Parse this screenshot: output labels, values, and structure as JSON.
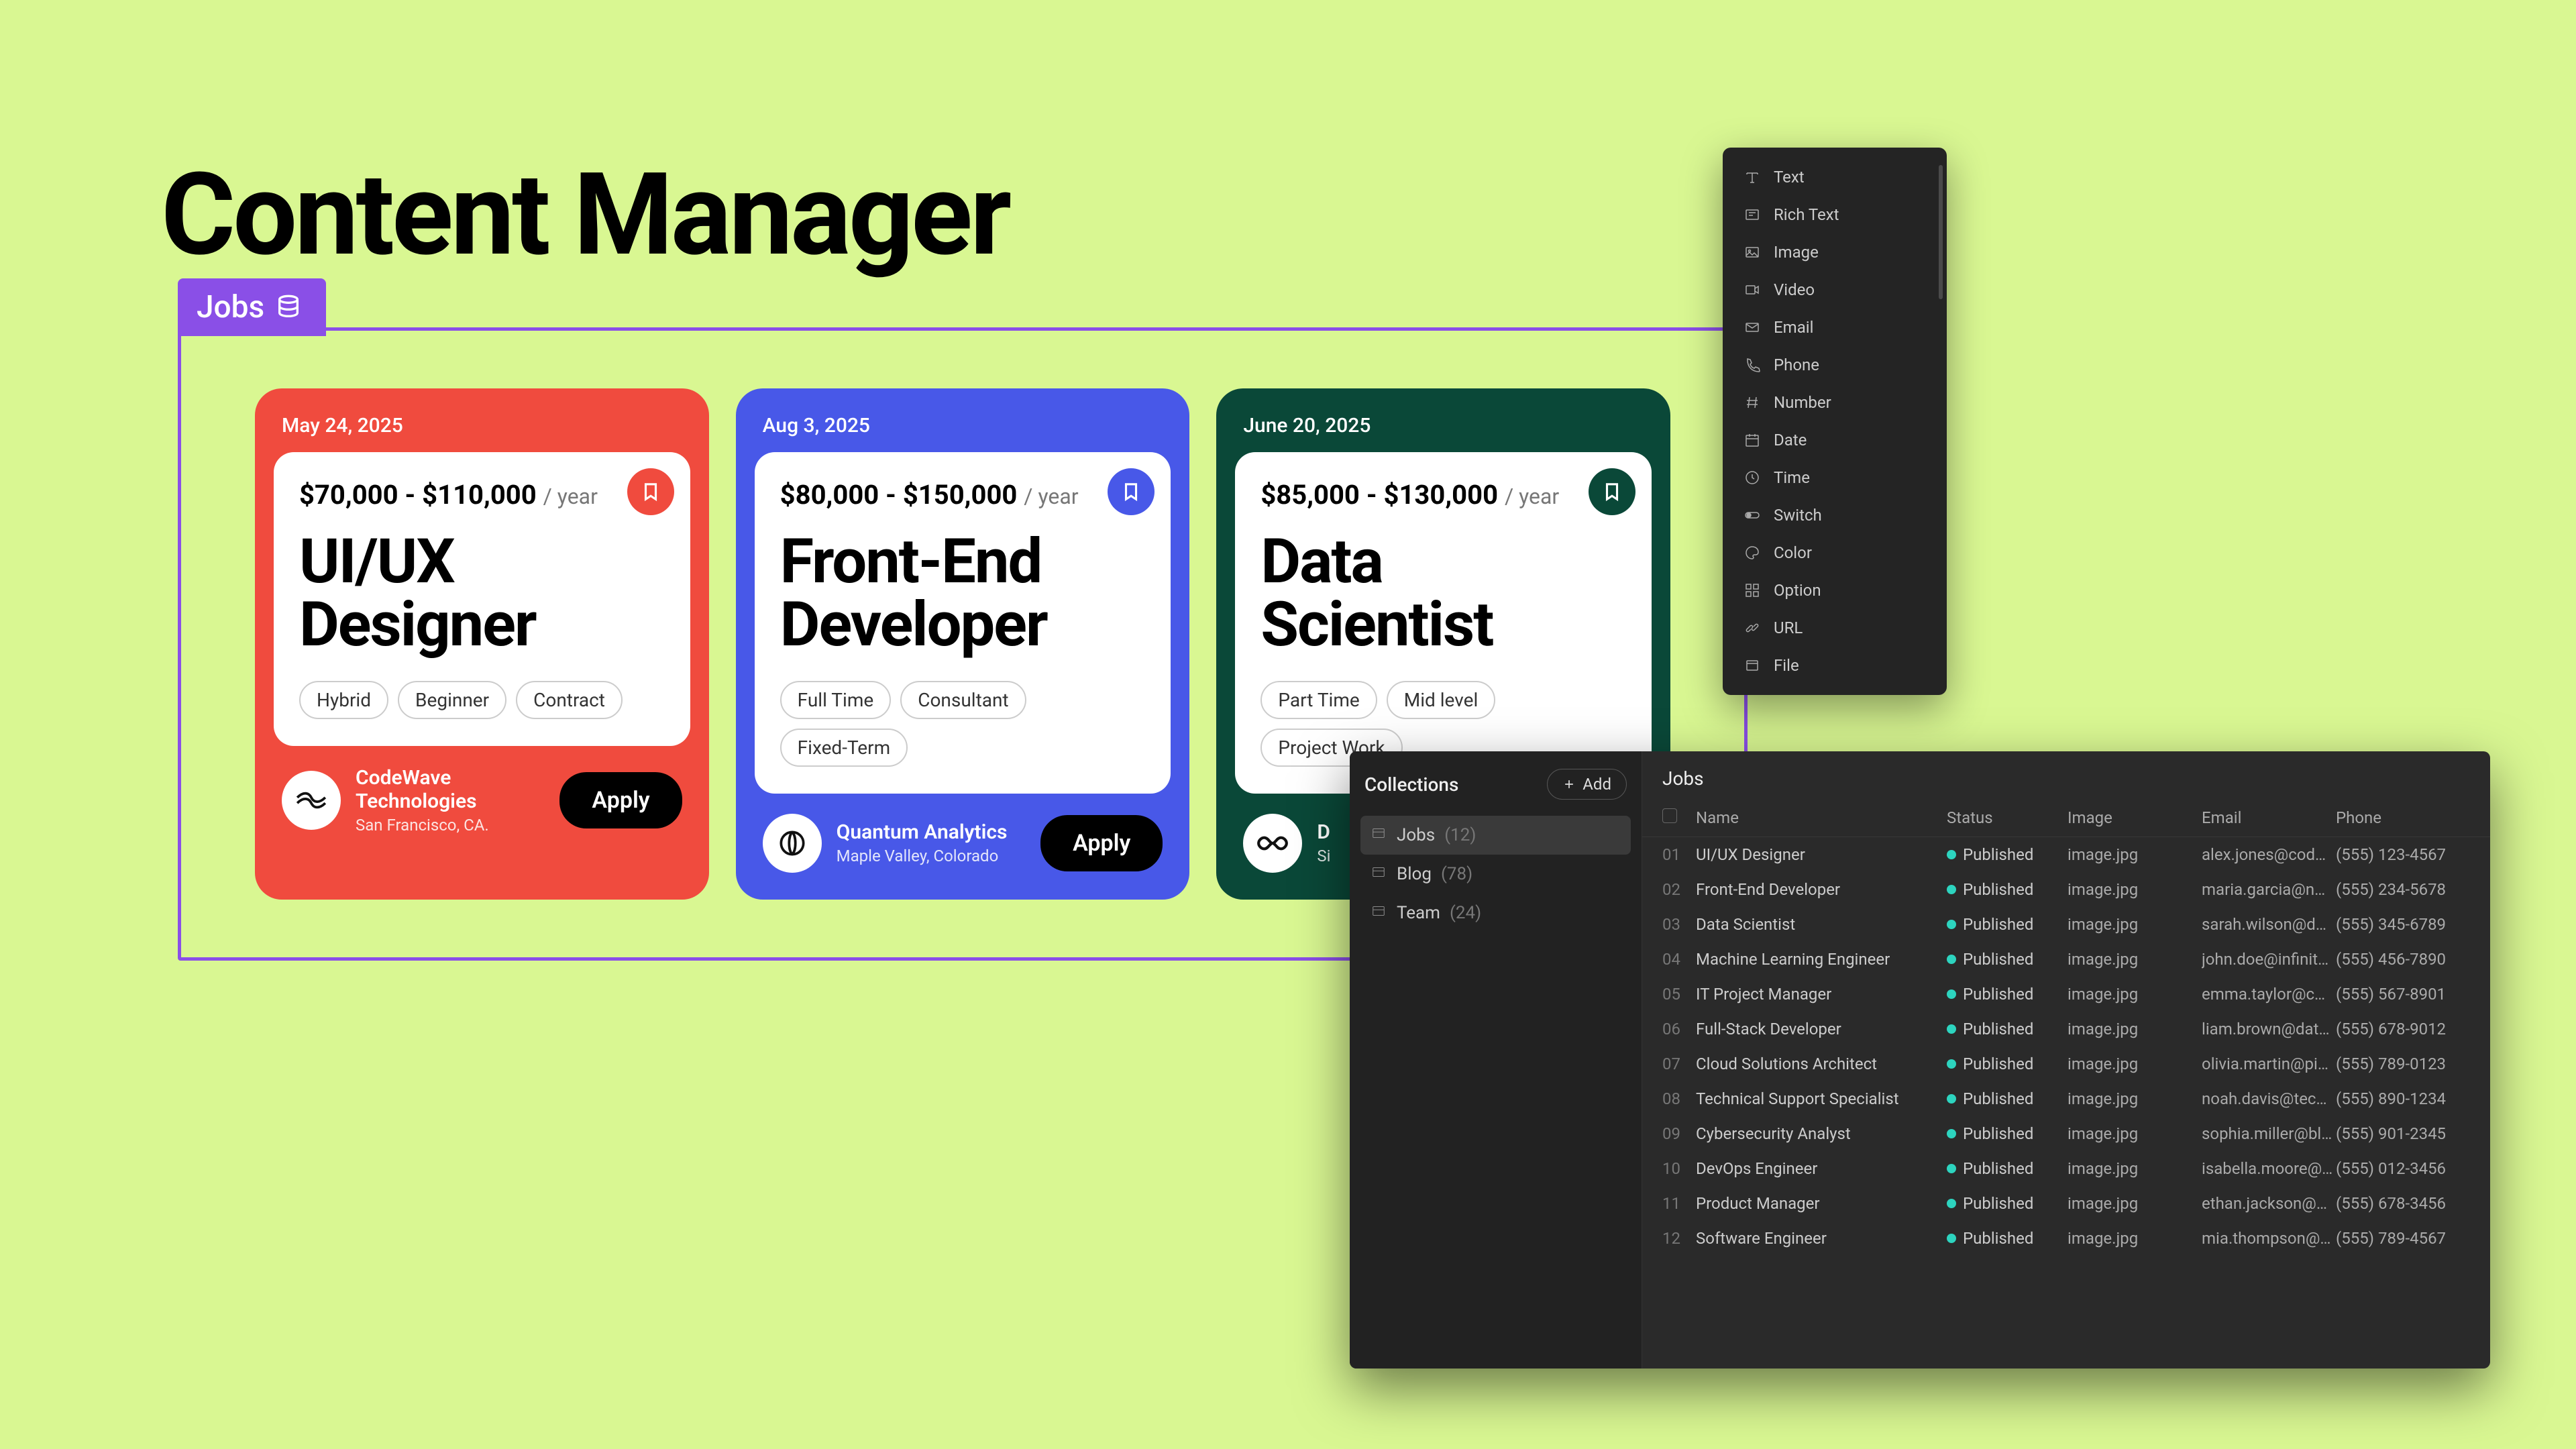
{
  "page_title": "Content Manager",
  "jobs_tab_label": "Jobs",
  "fields_menu": [
    "Text",
    "Rich Text",
    "Image",
    "Video",
    "Email",
    "Phone",
    "Number",
    "Date",
    "Time",
    "Switch",
    "Color",
    "Option",
    "URL",
    "File"
  ],
  "cards": [
    {
      "date": "May 24, 2025",
      "salary": "$70,000 - $110,000",
      "per": "/ year",
      "title_l1": "UI/UX",
      "title_l2": "Designer",
      "tags": [
        "Hybrid",
        "Beginner",
        "Contract"
      ],
      "company": "CodeWave Technologies",
      "location": "San Francisco, CA.",
      "apply": "Apply",
      "color": "red"
    },
    {
      "date": "Aug 3, 2025",
      "salary": "$80,000 - $150,000",
      "per": "/ year",
      "title_l1": "Front-End",
      "title_l2": "Developer",
      "tags": [
        "Full Time",
        "Consultant",
        "Fixed-Term"
      ],
      "company": "Quantum Analytics",
      "location": "Maple Valley, Colorado",
      "apply": "Apply",
      "color": "blue"
    },
    {
      "date": "June 20, 2025",
      "salary": "$85,000 - $130,000",
      "per": "/ year",
      "title_l1": "Data",
      "title_l2": "Scientist",
      "tags": [
        "Part Time",
        "Mid level",
        "Project Work"
      ],
      "company": "D",
      "location": "Si",
      "apply": "",
      "color": "green"
    }
  ],
  "cms": {
    "sidebar_title": "Collections",
    "add_label": "Add",
    "collections": [
      {
        "name": "Jobs",
        "count": "(12)",
        "active": true
      },
      {
        "name": "Blog",
        "count": "(78)",
        "active": false
      },
      {
        "name": "Team",
        "count": "(24)",
        "active": false
      }
    ],
    "main_title": "Jobs",
    "columns": {
      "name": "Name",
      "status": "Status",
      "image": "Image",
      "email": "Email",
      "phone": "Phone"
    },
    "status_label": "Published",
    "image_label": "image.jpg",
    "rows": [
      {
        "n": "01",
        "name": "UI/UX Designer",
        "email": "alex.jones@cod…",
        "phone": "(555) 123-4567"
      },
      {
        "n": "02",
        "name": "Front-End Developer",
        "email": "maria.garcia@n…",
        "phone": "(555) 234-5678"
      },
      {
        "n": "03",
        "name": "Data Scientist",
        "email": "sarah.wilson@d…",
        "phone": "(555) 345-6789"
      },
      {
        "n": "04",
        "name": "Machine Learning Engineer",
        "email": "john.doe@infinit…",
        "phone": "(555) 456-7890"
      },
      {
        "n": "05",
        "name": "IT Project Manager",
        "email": "emma.taylor@c…",
        "phone": "(555) 567-8901"
      },
      {
        "n": "06",
        "name": "Full-Stack Developer",
        "email": "liam.brown@dat…",
        "phone": "(555) 678-9012"
      },
      {
        "n": "07",
        "name": "Cloud Solutions Architect",
        "email": "olivia.martin@pi…",
        "phone": "(555) 789-0123"
      },
      {
        "n": "08",
        "name": "Technical Support Specialist",
        "email": "noah.davis@tec…",
        "phone": "(555) 890-1234"
      },
      {
        "n": "09",
        "name": "Cybersecurity Analyst",
        "email": "sophia.miller@bl…",
        "phone": "(555) 901-2345"
      },
      {
        "n": "10",
        "name": "DevOps Engineer",
        "email": "isabella.moore@…",
        "phone": "(555) 012-3456"
      },
      {
        "n": "11",
        "name": "Product Manager",
        "email": "ethan.jackson@…",
        "phone": "(555) 678-3456"
      },
      {
        "n": "12",
        "name": "Software Engineer",
        "email": "mia.thompson@…",
        "phone": "(555) 789-4567"
      }
    ]
  }
}
